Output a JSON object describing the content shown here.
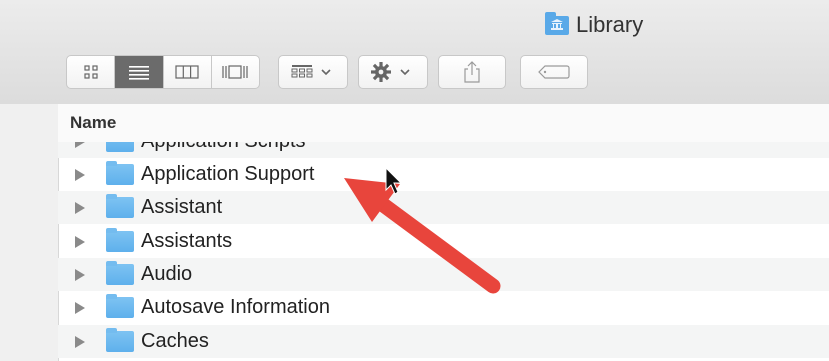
{
  "window": {
    "title": "Library"
  },
  "toolbar": {
    "view_buttons": [
      {
        "icon": "icon-view-icon",
        "active": false
      },
      {
        "icon": "list-view-icon",
        "active": true
      },
      {
        "icon": "column-view-icon",
        "active": false
      },
      {
        "icon": "cover-flow-view-icon",
        "active": false
      }
    ],
    "arrange_icon": "arrange-grid-icon",
    "action_icon": "gear-icon",
    "share_icon": "share-icon",
    "tag_icon": "tag-icon"
  },
  "list": {
    "column_header": "Name",
    "items": [
      {
        "label": "Application Scripts"
      },
      {
        "label": "Application Support"
      },
      {
        "label": "Assistant"
      },
      {
        "label": "Assistants"
      },
      {
        "label": "Audio"
      },
      {
        "label": "Autosave Information"
      },
      {
        "label": "Caches"
      }
    ]
  },
  "colors": {
    "folder": "#5eb0ec",
    "annotation_arrow": "#e8453c"
  }
}
